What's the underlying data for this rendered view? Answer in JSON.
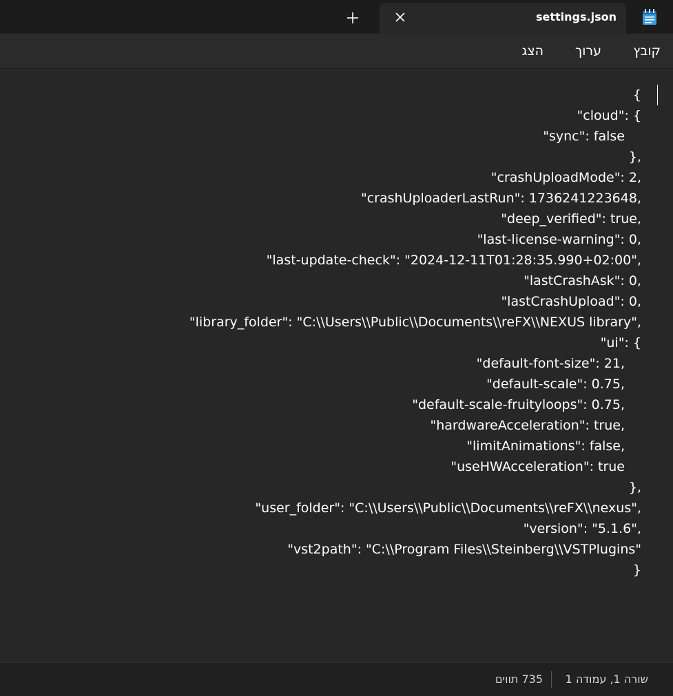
{
  "tab": {
    "title": "settings.json"
  },
  "icons": {
    "app": "notepad-icon",
    "close": "close-icon",
    "new_tab": "plus-icon"
  },
  "menu": {
    "file": "קובץ",
    "edit": "ערוך",
    "view": "הצג"
  },
  "editor": {
    "lines": [
      "{",
      "\"cloud\": {",
      "\"sync\": false",
      "},",
      "\"crashUploadMode\": 2,",
      "\"crashUploaderLastRun\": 1736241223648,",
      "\"deep_verified\": true,",
      "\"last-license-warning\": 0,",
      "\"last-update-check\": \"2024-12-11T01:28:35.990+02:00\",",
      "\"lastCrashAsk\": 0,",
      "\"lastCrashUpload\": 0,",
      "\"library_folder\": \"C:\\\\Users\\\\Public\\\\Documents\\\\reFX\\\\NEXUS library\",",
      "\"ui\": {",
      "\"default-font-size\": 21,",
      "\"default-scale\": 0.75,",
      "\"default-scale-fruityloops\": 0.75,",
      "\"hardwareAcceleration\": true,",
      "\"limitAnimations\": false,",
      "\"useHWAcceleration\": true",
      "},",
      "\"user_folder\": \"C:\\\\Users\\\\Public\\\\Documents\\\\reFX\\\\nexus\",",
      "\"version\": \"5.1.6\",",
      "\"vst2path\": \"C:\\\\Program Files\\\\Steinberg\\\\VSTPlugins\"",
      "}"
    ]
  },
  "status": {
    "position": "שורה 1, עמודה 1",
    "characters": "735 תווים"
  }
}
